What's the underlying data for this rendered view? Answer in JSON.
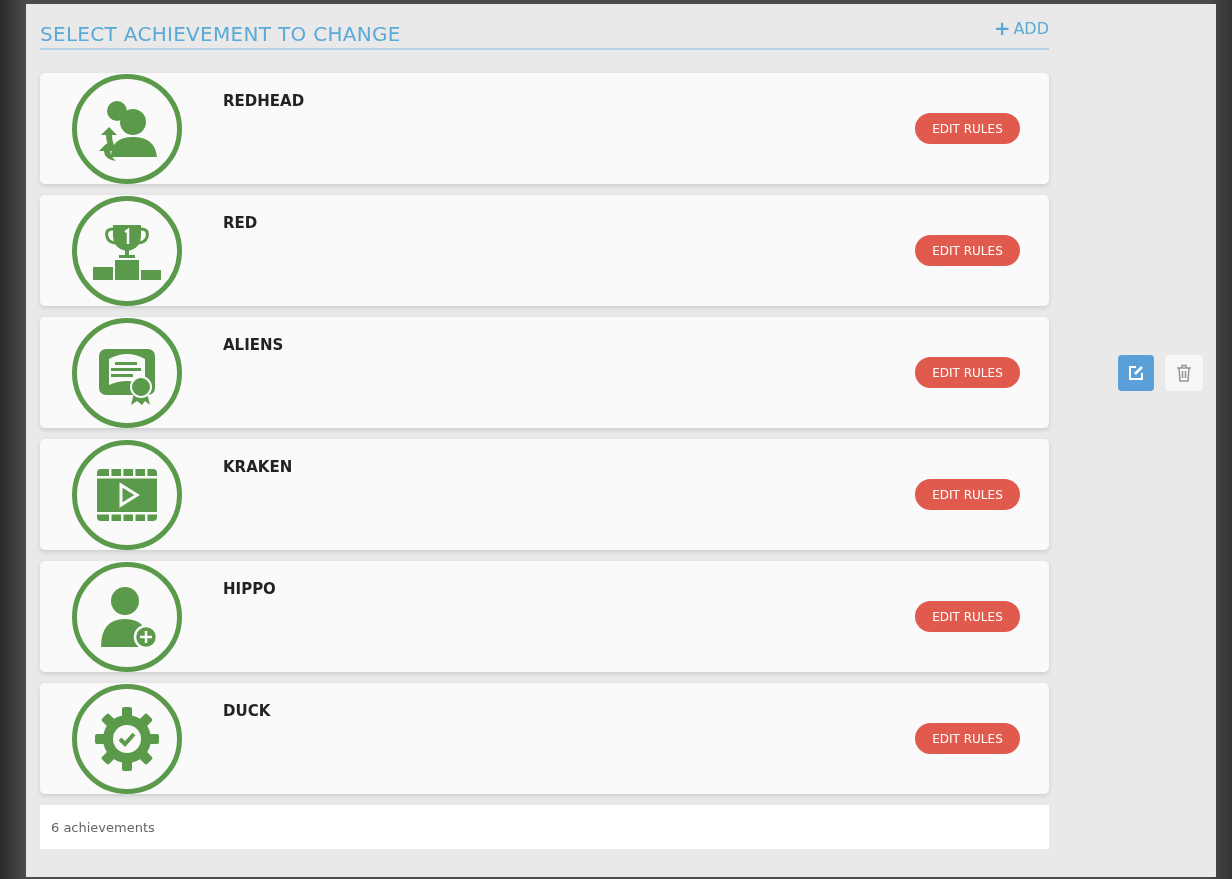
{
  "header": {
    "title": "SELECT ACHIEVEMENT TO CHANGE",
    "add_link": {
      "icon": "+",
      "label": "ADD"
    }
  },
  "achievements": [
    {
      "name": "REDHEAD",
      "kind": "group",
      "button": "EDIT RULES"
    },
    {
      "name": "RED",
      "kind": "podium",
      "button": "EDIT RULES"
    },
    {
      "name": "ALIENS",
      "kind": "certificate",
      "button": "EDIT RULES"
    },
    {
      "name": "KRAKEN",
      "kind": "video",
      "button": "EDIT RULES"
    },
    {
      "name": "HIPPO",
      "kind": "user-add",
      "button": "EDIT RULES"
    },
    {
      "name": "DUCK",
      "kind": "gear-check",
      "button": "EDIT RULES"
    }
  ],
  "footer": {
    "count": "6 achievements"
  }
}
